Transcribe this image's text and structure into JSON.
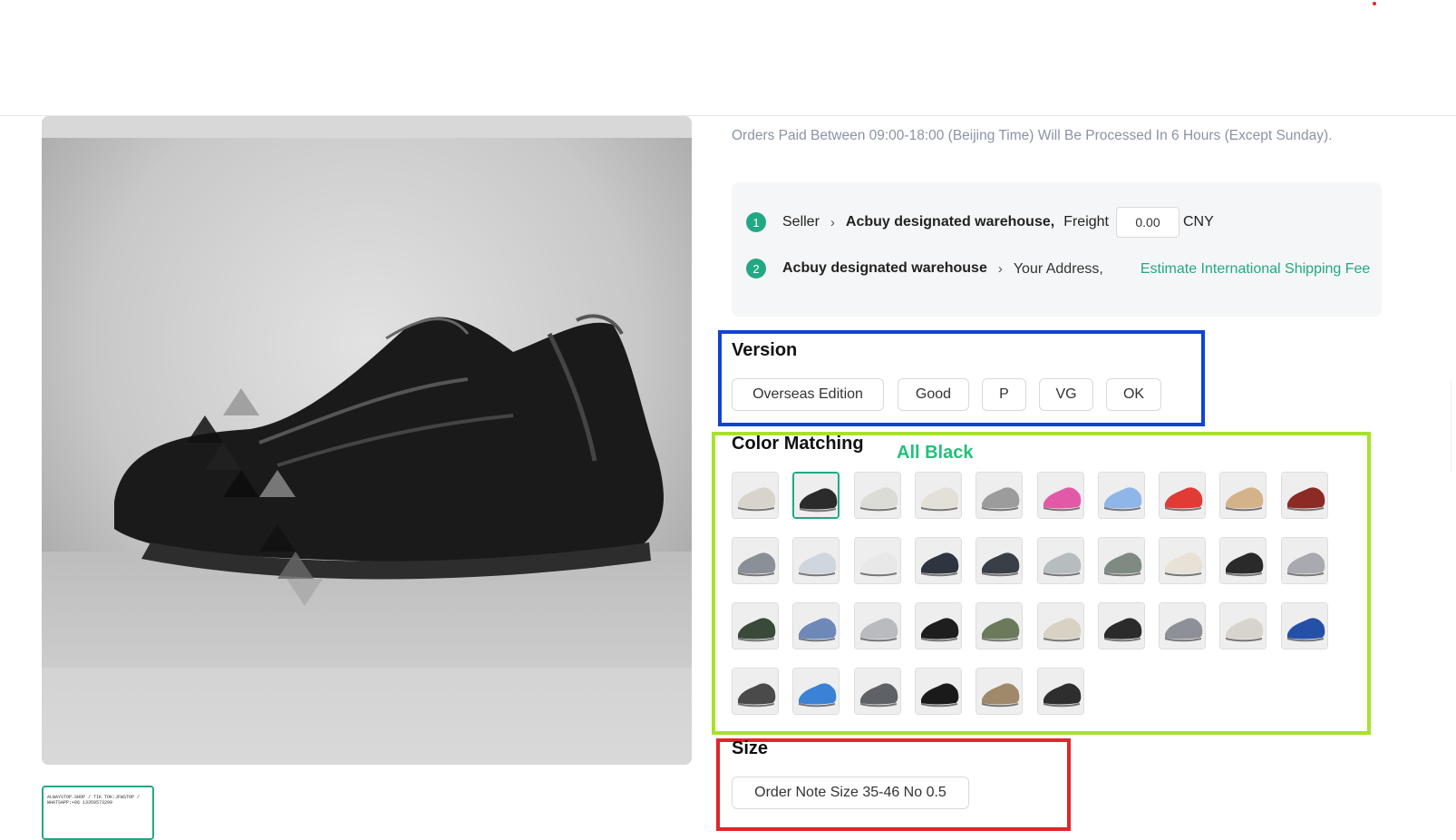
{
  "notice": "Orders Paid Between 09:00-18:00 (Beijing Time) Will Be Processed In 6 Hours (Except Sunday).",
  "shipping": {
    "step1": "1",
    "step2": "2",
    "seller": "Seller",
    "warehouse1": "Acbuy designated warehouse,",
    "freight_label": "Freight",
    "freight_value": "0.00",
    "currency": "CNY",
    "warehouse2": "Acbuy designated warehouse",
    "address": "Your Address,",
    "estimate_link": "Estimate International Shipping Fee"
  },
  "version": {
    "title": "Version",
    "options": [
      "Overseas Edition",
      "Good",
      "P",
      "VG",
      "OK"
    ]
  },
  "color": {
    "title": "Color Matching",
    "selected": "All Black",
    "swatches": [
      "#d8d4cc",
      "#2b2b2b",
      "#dcdcd6",
      "#e3e0d8",
      "#9c9c9c",
      "#e25aa7",
      "#8fb6e8",
      "#e03b35",
      "#d4b28a",
      "#8c2a25",
      "#8a8f98",
      "#cfd6de",
      "#e8e8e8",
      "#2e3440",
      "#3a3f47",
      "#b7bcbf",
      "#7f8a83",
      "#e8e2d6",
      "#2a2a2a",
      "#a8aab0",
      "#3a4a3a",
      "#6e88b8",
      "#b9bbbf",
      "#1e1e1e",
      "#6b7a5a",
      "#d8d2c4",
      "#2b2b2b",
      "#8d9096",
      "#d6d4cc",
      "#2450a8",
      "#4a4a4a",
      "#3b82d6",
      "#5e6266",
      "#1a1a1a",
      "#a0886a",
      "#2e2e2e"
    ]
  },
  "size": {
    "title": "Size",
    "option": "Order Note Size 35-46 No 0.5"
  },
  "thumbnail_text": "ALWAYSTOP.SHOP / TIK TOK:JFWSTOP / WHATSAPP:+86 13359573209"
}
